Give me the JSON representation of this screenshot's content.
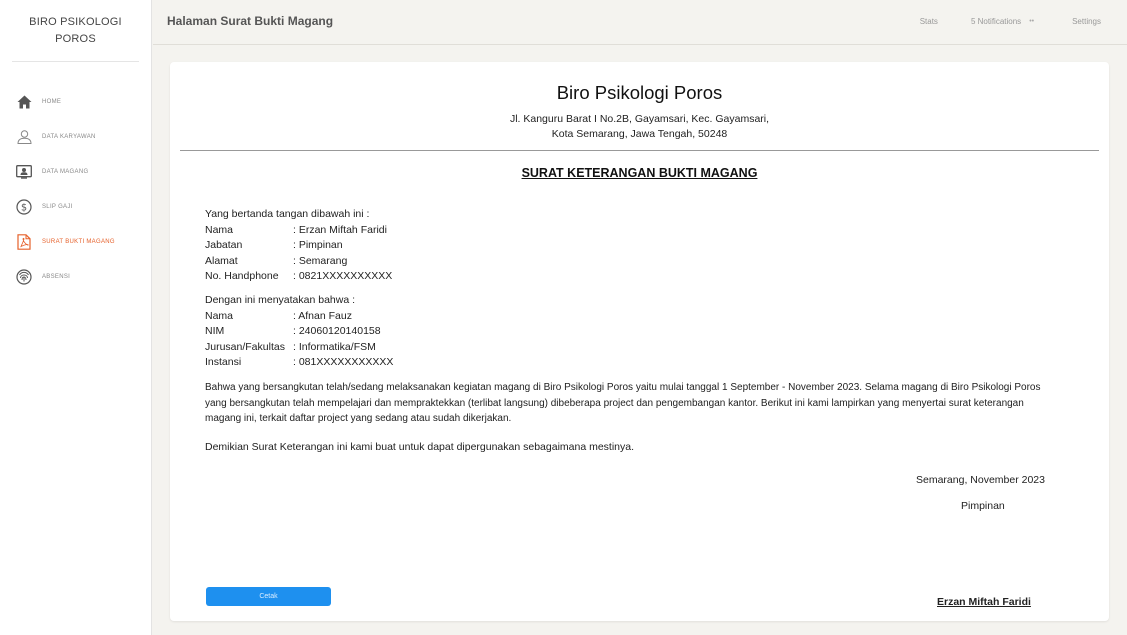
{
  "sidebar": {
    "brand_line1": "BIRO PSIKOLOGI",
    "brand_line2": "POROS",
    "items": [
      {
        "label": "HOME",
        "icon": "home-icon"
      },
      {
        "label": "DATA KARYAWAN",
        "icon": "user-icon"
      },
      {
        "label": "DATA MAGANG",
        "icon": "id-card-icon"
      },
      {
        "label": "SLIP GAJI",
        "icon": "dollar-icon"
      },
      {
        "label": "SURAT BUKTI MAGANG",
        "icon": "pdf-icon"
      },
      {
        "label": "ABSENSI",
        "icon": "fingerprint-icon"
      }
    ],
    "active_color": "#e6602a"
  },
  "header": {
    "title": "Halaman Surat Bukti Magang",
    "stats": "Stats",
    "notifications": "5 Notifications",
    "dots": "••",
    "settings": "Settings"
  },
  "letter": {
    "org_name": "Biro Psikologi Poros",
    "address_line1": "Jl. Kanguru Barat I No.2B, Gayamsari, Kec. Gayamsari,",
    "address_line2": "Kota Semarang, Jawa Tengah, 50248",
    "title": "SURAT KETERANGAN BUKTI MAGANG",
    "intro": "Yang bertanda tangan dibawah ini :",
    "signer": [
      {
        "k": "Nama",
        "v": ": Erzan Miftah Faridi"
      },
      {
        "k": "Jabatan",
        "v": ": Pimpinan"
      },
      {
        "k": "Alamat",
        "v": ": Semarang"
      },
      {
        "k": "No. Handphone",
        "v": ": 0821XXXXXXXXXX"
      }
    ],
    "statement": "Dengan ini menyatakan bahwa :",
    "intern": [
      {
        "k": "Nama",
        "v": ": Afnan Fauz"
      },
      {
        "k": "NIM",
        "v": ": 24060120140158"
      },
      {
        "k": "Jurusan/Fakultas",
        "v": ": Informatika/FSM"
      },
      {
        "k": "Instansi",
        "v": ": 081XXXXXXXXXXX"
      }
    ],
    "body_line1": "Bahwa yang bersangkutan telah/sedang melaksanakan kegiatan magang di Biro Psikologi Poros yaitu mulai tanggal 1 September - November 2023. Selama magang di Biro Psikologi Poros",
    "body_line2": "yang bersangkutan telah mempelajari dan mempraktekkan (terlibat langsung) dibeberapa project dan pengembangan kantor. Berikut ini kami lampirkan yang menyertai surat keterangan",
    "body_line3": "magang ini, terkait daftar project yang sedang atau sudah dikerjakan.",
    "closing": "Demikian Surat Keterangan ini kami buat untuk dapat dipergunakan sebagaimana mestinya.",
    "place_date": "Semarang,    November 2023",
    "position": "Pimpinan",
    "signer_name": "Erzan Miftah Faridi",
    "print_button": "Cetak"
  }
}
